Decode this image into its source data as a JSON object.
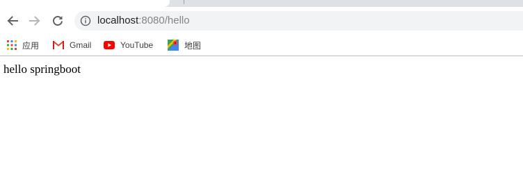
{
  "address_bar": {
    "host": "localhost",
    "rest": ":8080/hello"
  },
  "bookmarks": [
    {
      "label": "应用",
      "icon": "apps-grid-icon"
    },
    {
      "label": "Gmail",
      "icon": "gmail-icon"
    },
    {
      "label": "YouTube",
      "icon": "youtube-icon"
    },
    {
      "label": "地图",
      "icon": "maps-icon"
    }
  ],
  "page": {
    "body_text": "hello springboot"
  },
  "colors": {
    "tabstrip_bg": "#dee1e6",
    "omnibox_bg": "#f1f3f4",
    "url_secondary": "#80868b"
  }
}
